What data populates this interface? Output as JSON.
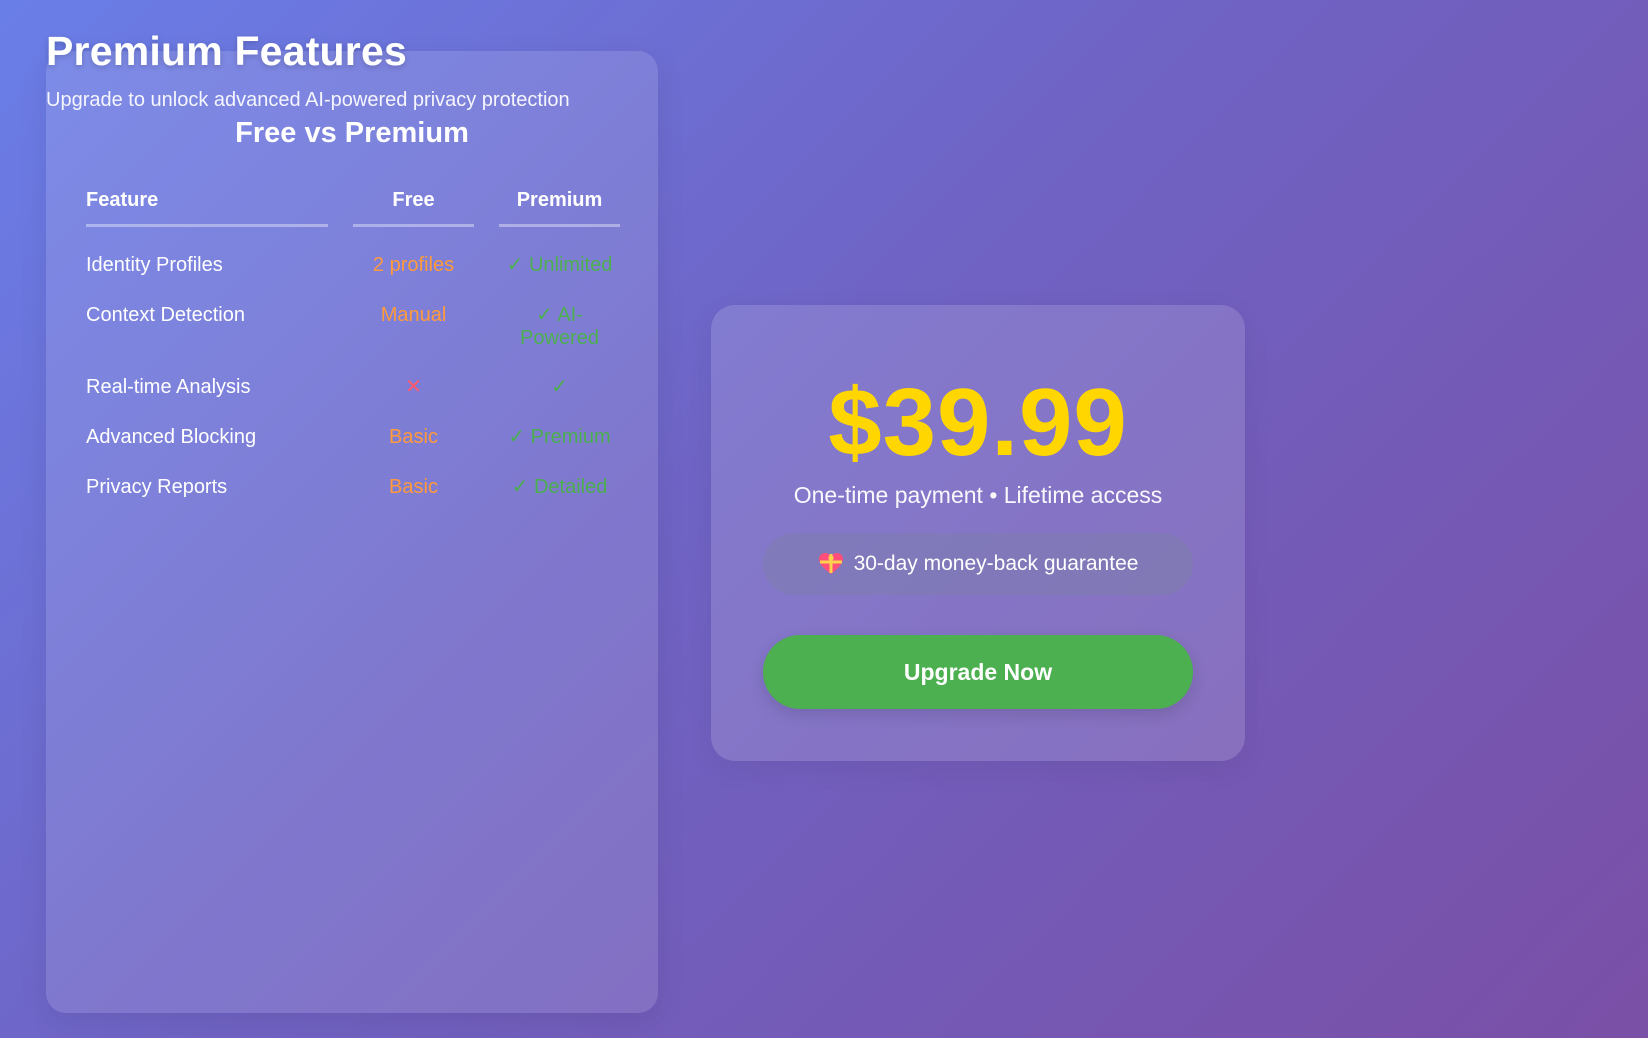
{
  "header": {
    "title": "Premium Features",
    "subtitle": "Upgrade to unlock advanced AI-powered privacy protection"
  },
  "comparison": {
    "title": "Free vs Premium",
    "columns": {
      "feature": "Feature",
      "free": "Free",
      "premium": "Premium"
    },
    "rows": [
      {
        "feature": "Identity Profiles",
        "free": "2 profiles",
        "premium": "✓ Unlimited"
      },
      {
        "feature": "Context Detection",
        "free": "Manual",
        "premium": "✓ AI-Powered"
      },
      {
        "feature": "Real-time Analysis",
        "free": "✕",
        "premium": "✓"
      },
      {
        "feature": "Advanced Blocking",
        "free": "Basic",
        "premium": "✓ Premium"
      },
      {
        "feature": "Privacy Reports",
        "free": "Basic",
        "premium": "✓ Detailed"
      }
    ]
  },
  "pricing": {
    "price": "$39.99",
    "note": "One-time payment • Lifetime access",
    "guarantee_icon": "heart-gift-icon",
    "guarantee": "30-day money-back guarantee",
    "upgrade_label": "Upgrade Now"
  },
  "colors": {
    "background_start": "#6a7ee8",
    "background_end": "#7a4fa6",
    "price": "#ffd600",
    "free_value": "#ff9a3c",
    "cross": "#ff5a6e",
    "premium_value": "#4caf50",
    "button": "#4caf50"
  }
}
